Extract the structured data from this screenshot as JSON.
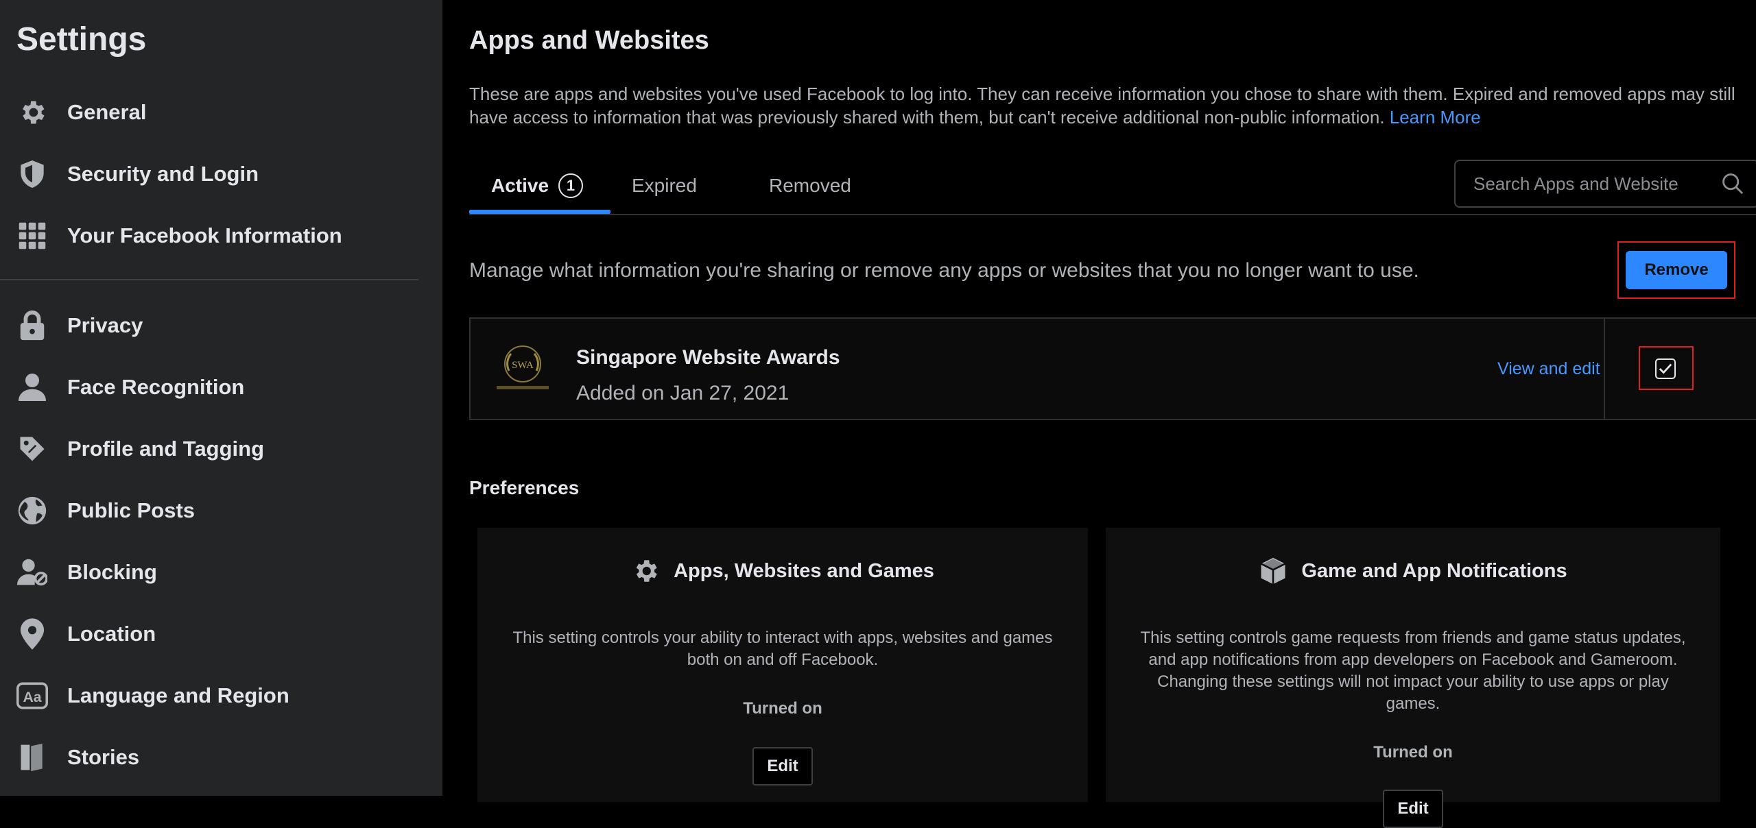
{
  "sidebar": {
    "title": "Settings",
    "items": [
      {
        "label": "General",
        "icon": "gear-icon"
      },
      {
        "label": "Security and Login",
        "icon": "shield-icon"
      },
      {
        "label": "Your Facebook Information",
        "icon": "grid-icon"
      },
      {
        "label": "Privacy",
        "icon": "lock-icon"
      },
      {
        "label": "Face Recognition",
        "icon": "person-icon"
      },
      {
        "label": "Profile and Tagging",
        "icon": "tag-icon"
      },
      {
        "label": "Public Posts",
        "icon": "globe-icon"
      },
      {
        "label": "Blocking",
        "icon": "person-blocked-icon"
      },
      {
        "label": "Location",
        "icon": "map-pin-icon"
      },
      {
        "label": "Language and Region",
        "icon": "language-icon"
      },
      {
        "label": "Stories",
        "icon": "book-icon"
      }
    ]
  },
  "main": {
    "title": "Apps and Websites",
    "description": "These are apps and websites you've used Facebook to log into. They can receive information you chose to share with them. Expired and removed apps may still have access to information that was previously shared with them, but can't receive additional non-public information.",
    "learn_more": "Learn More",
    "tabs": [
      {
        "label": "Active",
        "badge": "1"
      },
      {
        "label": "Expired"
      },
      {
        "label": "Removed"
      }
    ],
    "search": {
      "placeholder": "Search Apps and Websites"
    },
    "manage_text": "Manage what information you're sharing or remove any apps or websites that you no longer want to use.",
    "remove_label": "Remove",
    "apps": [
      {
        "name": "Singapore Website Awards",
        "added": "Added on Jan 27, 2021",
        "view_label": "View and edit",
        "checked": true
      }
    ],
    "preferences": {
      "title": "Preferences",
      "cards": [
        {
          "icon": "gear-icon",
          "title": "Apps, Websites and Games",
          "description": "This setting controls your ability to interact with apps, websites and games both on and off Facebook.",
          "status": "Turned on",
          "edit_label": "Edit"
        },
        {
          "icon": "cube-icon",
          "title": "Game and App Notifications",
          "description": "This setting controls game requests from friends and game status updates, and app notifications from app developers on Facebook and Gameroom. Changing these settings will not impact your ability to use apps or play games.",
          "status": "Turned on",
          "edit_label": "Edit"
        }
      ]
    }
  },
  "colors": {
    "sidebar_bg": "#242526",
    "accent": "#2d88ff",
    "link": "#4599ff",
    "highlight_outline": "#e02020"
  }
}
